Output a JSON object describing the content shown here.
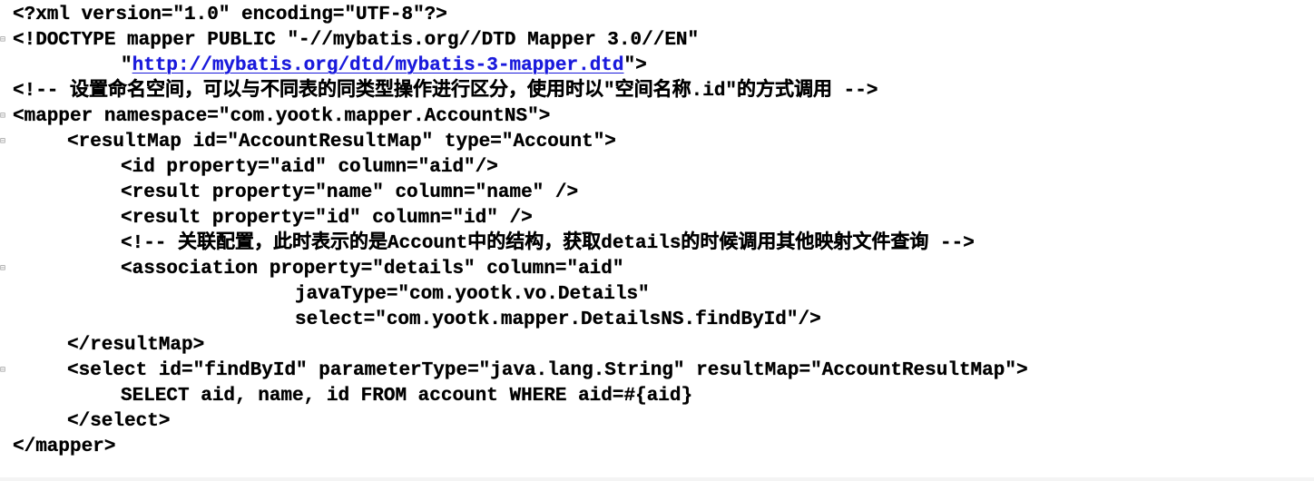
{
  "editor": {
    "lines": [
      {
        "text": "<?xml version=\"1.0\" encoding=\"UTF-8\"?>",
        "fold": false
      },
      {
        "text": "<!DOCTYPE mapper PUBLIC \"-//mybatis.org//DTD Mapper 3.0//EN\"",
        "fold": true
      },
      {
        "pre": "\"",
        "link": "http://mybatis.org/dtd/mybatis-3-mapper.dtd",
        "post": "\">",
        "fold": false
      },
      {
        "text": "<!-- 设置命名空间，可以与不同表的同类型操作进行区分，使用时以\"空间名称.id\"的方式调用 -->",
        "fold": false
      },
      {
        "text": "<mapper namespace=\"com.yootk.mapper.AccountNS\">",
        "fold": true
      },
      {
        "text": "<resultMap id=\"AccountResultMap\" type=\"Account\">",
        "fold": true
      },
      {
        "text": "<id property=\"aid\" column=\"aid\"/>",
        "fold": false
      },
      {
        "text": "<result property=\"name\" column=\"name\" />",
        "fold": false
      },
      {
        "text": "<result property=\"id\" column=\"id\" />",
        "fold": false
      },
      {
        "text": "<!-- 关联配置，此时表示的是Account中的结构，获取details的时候调用其他映射文件查询 -->",
        "fold": false
      },
      {
        "text": "<association property=\"details\" column=\"aid\"",
        "fold": true
      },
      {
        "text": "javaType=\"com.yootk.vo.Details\"",
        "fold": false
      },
      {
        "text": "select=\"com.yootk.mapper.DetailsNS.findById\"/>",
        "fold": false
      },
      {
        "text": "</resultMap>",
        "fold": false
      },
      {
        "text": "<select id=\"findById\" parameterType=\"java.lang.String\" resultMap=\"AccountResultMap\">",
        "fold": true
      },
      {
        "text": "SELECT aid, name, id FROM account WHERE aid=#{aid}",
        "fold": false
      },
      {
        "text": "</select>",
        "fold": false
      },
      {
        "text": "</mapper>",
        "fold": false
      }
    ],
    "fold_glyph": "⊟"
  },
  "colors": {
    "text": "#000000",
    "link": "#1a1adc",
    "fold_marker": "#9a9a9a",
    "background": "#ffffff"
  }
}
